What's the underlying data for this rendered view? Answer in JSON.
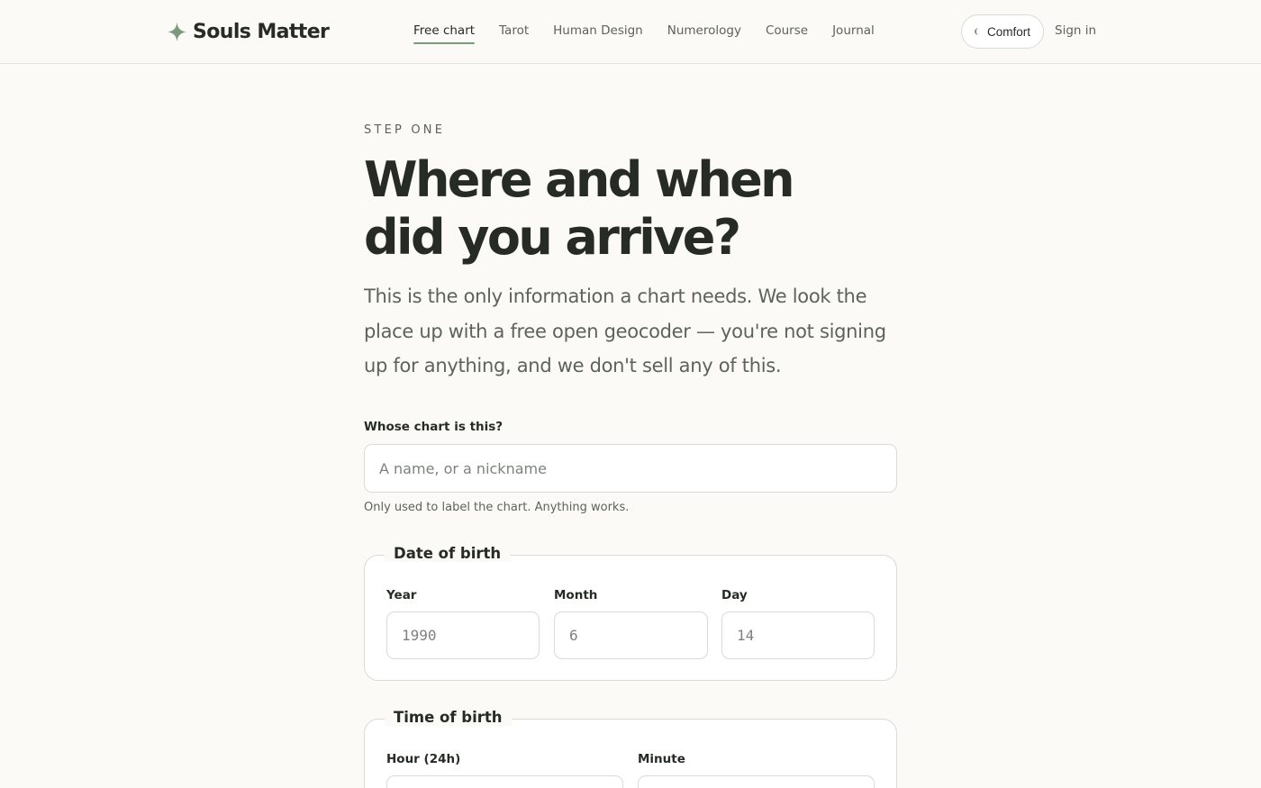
{
  "brand": {
    "name": "Souls Matter",
    "icon": "sparkle-icon",
    "accent_color": "#7a9a7c"
  },
  "nav": {
    "items": [
      {
        "label": "Free chart",
        "active": true
      },
      {
        "label": "Tarot",
        "active": false
      },
      {
        "label": "Human Design",
        "active": false
      },
      {
        "label": "Numerology",
        "active": false
      },
      {
        "label": "Course",
        "active": false
      },
      {
        "label": "Journal",
        "active": false
      }
    ]
  },
  "header": {
    "comfort_label": "Comfort",
    "signin_label": "Sign in"
  },
  "main": {
    "eyebrow": "STEP ONE",
    "title_line1": "Where and when",
    "title_line2": "did you arrive?",
    "intro": "This is the only information a chart needs. We look the place up with a free open geocoder — you're not signing up for anything, and we don't sell any of this.",
    "name_field": {
      "label": "Whose chart is this?",
      "placeholder": "A name, or a nickname",
      "value": "",
      "helper": "Only used to label the chart. Anything works."
    },
    "date_of_birth": {
      "legend": "Date of birth",
      "year": {
        "label": "Year",
        "placeholder": "1990"
      },
      "month": {
        "label": "Month",
        "placeholder": "6"
      },
      "day": {
        "label": "Day",
        "placeholder": "14"
      }
    },
    "time_of_birth": {
      "legend": "Time of birth",
      "hour": {
        "label": "Hour (24h)"
      },
      "minute": {
        "label": "Minute"
      }
    }
  }
}
